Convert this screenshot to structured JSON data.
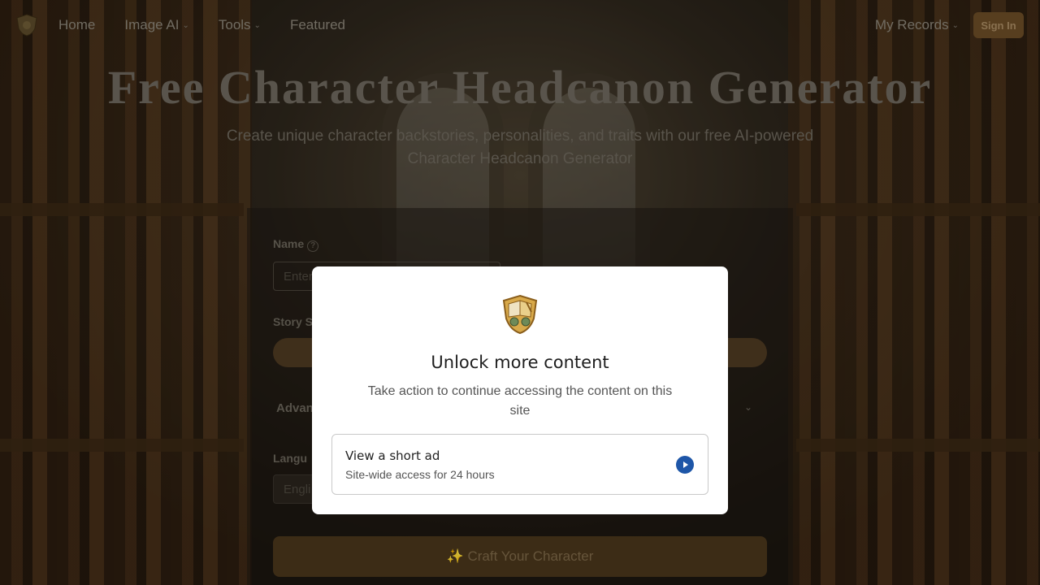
{
  "nav": {
    "home": "Home",
    "image_ai": "Image AI",
    "tools": "Tools",
    "featured": "Featured",
    "my_records": "My Records",
    "sign_in": "Sign In"
  },
  "hero": {
    "title": "Free Character Headcanon Generator",
    "subtitle": "Create unique character backstories, personalities, and traits with our free AI-powered Character Headcanon Generator"
  },
  "form": {
    "name_label": "Name",
    "name_placeholder": "Enter",
    "story_label": "Story S",
    "advanced_label": "Advan",
    "language_label": "Langu",
    "language_value": "Engli",
    "craft_button": "✨ Craft Your Character"
  },
  "modal": {
    "title": "Unlock more content",
    "description": "Take action to continue accessing the content on this site",
    "option_title": "View a short ad",
    "option_subtitle": "Site-wide access for 24 hours"
  },
  "colors": {
    "accent": "#1e56a8",
    "sign_in_bg": "#6b4c26"
  }
}
